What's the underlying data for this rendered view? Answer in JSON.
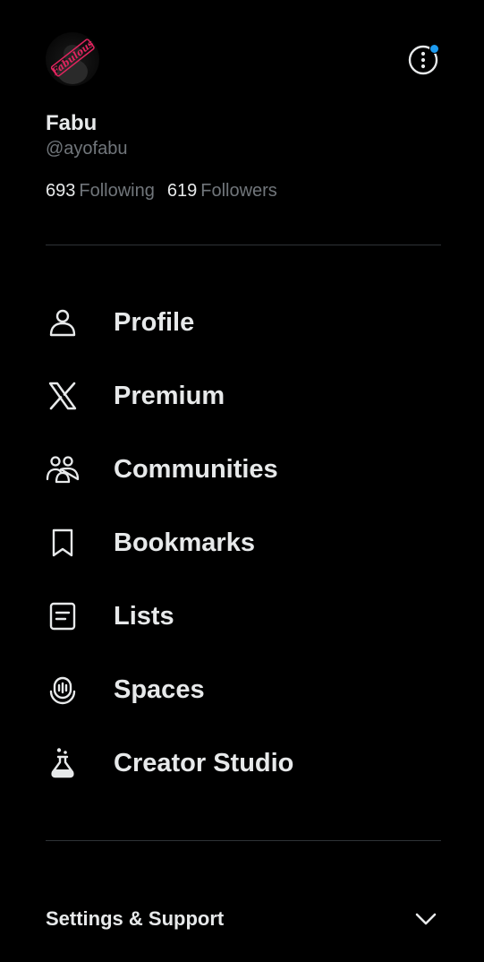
{
  "profile": {
    "display_name": "Fabu",
    "handle": "@ayofabu",
    "avatar_text": "Fabulous",
    "following_count": "693",
    "following_label": "Following",
    "followers_count": "619",
    "followers_label": "Followers"
  },
  "menu": {
    "more_icon": "more-circle-icon",
    "badge_color": "#1d9bf0",
    "items": [
      {
        "label": "Profile",
        "icon": "person-icon"
      },
      {
        "label": "Premium",
        "icon": "x-logo-icon"
      },
      {
        "label": "Communities",
        "icon": "communities-icon"
      },
      {
        "label": "Bookmarks",
        "icon": "bookmark-icon"
      },
      {
        "label": "Lists",
        "icon": "list-icon"
      },
      {
        "label": "Spaces",
        "icon": "spaces-icon"
      },
      {
        "label": "Creator Studio",
        "icon": "flask-icon"
      }
    ]
  },
  "settings": {
    "label": "Settings & Support",
    "icon": "chevron-down-icon"
  },
  "colors": {
    "background": "#000000",
    "text_primary": "#e7e9ea",
    "text_secondary": "#71767b",
    "divider": "#2f3336",
    "accent": "#1d9bf0",
    "avatar_accent": "#e0245e"
  }
}
